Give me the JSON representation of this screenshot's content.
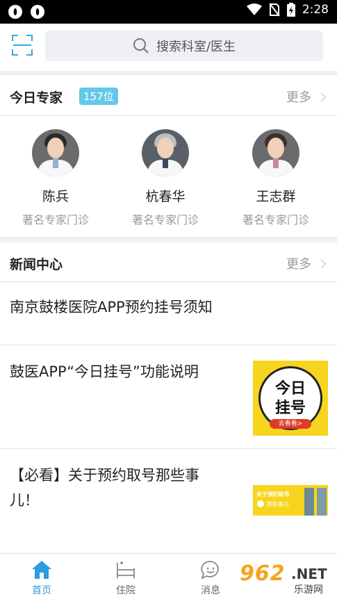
{
  "status_bar": {
    "time": "2:28"
  },
  "header": {
    "search_placeholder": "搜索科室/医生"
  },
  "experts_section": {
    "title": "今日专家",
    "count_badge": "157位",
    "more_label": "更多",
    "experts": [
      {
        "name": "陈兵",
        "tag": "著名专家门诊"
      },
      {
        "name": "杭春华",
        "tag": "著名专家门诊"
      },
      {
        "name": "王志群",
        "tag": "著名专家门诊"
      }
    ]
  },
  "news_section": {
    "title": "新闻中心",
    "more_label": "更多",
    "items": [
      {
        "title": "南京鼓楼医院APP预约挂号须知"
      },
      {
        "title": "鼓医APP“今日挂号”功能说明",
        "thumb_text_1": "今日",
        "thumb_text_2": "挂号",
        "thumb_button": "去看看>"
      },
      {
        "title_line1": "【必看】关于预约取号那些事",
        "title_line2": "儿！",
        "thumb_text_1": "关于预约取号",
        "thumb_text_2": "那些事儿"
      }
    ]
  },
  "bottom_nav": {
    "items": [
      {
        "label": "首页",
        "icon": "home-icon",
        "active": true
      },
      {
        "label": "住院",
        "icon": "bed-icon"
      },
      {
        "label": "消息",
        "icon": "message-icon"
      }
    ]
  },
  "watermark": {
    "number": "962",
    "suffix": ".NET",
    "site": "乐游网"
  },
  "colors": {
    "accent": "#2b9de0",
    "badge": "#64c8e8",
    "thumb_yellow": "#f7d51e",
    "watermark_orange": "#f6a31a"
  }
}
